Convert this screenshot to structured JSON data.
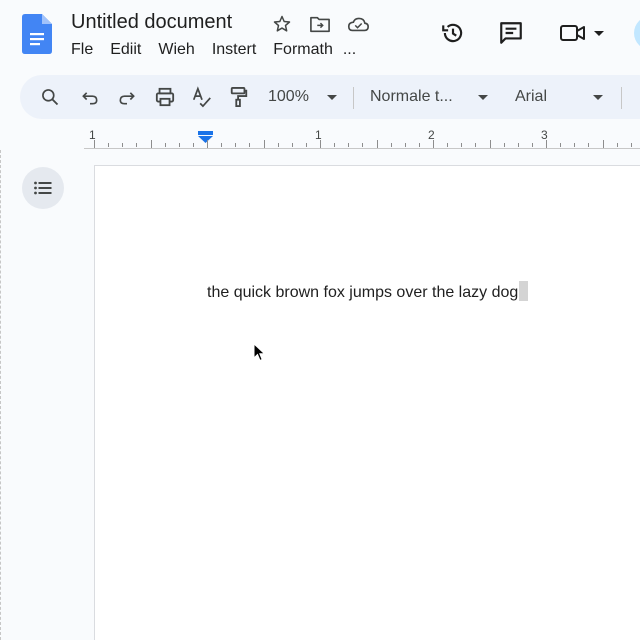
{
  "header": {
    "title": "Untitled document",
    "menu": [
      "Fle",
      "Ediit",
      "Wieh",
      "Instert",
      "Formath",
      "..."
    ],
    "title_icons": [
      "star-icon",
      "move-folder-icon",
      "cloud-status-icon"
    ],
    "right_icons": [
      "history-icon",
      "comments-icon",
      "meet-video-icon"
    ]
  },
  "toolbar": {
    "icons": [
      "search-icon",
      "undo-icon",
      "redo-icon",
      "print-icon",
      "spellcheck-icon",
      "paint-format-icon"
    ],
    "zoom": "100%",
    "style": "Normale t...",
    "font": "Arial"
  },
  "ruler": {
    "labels": [
      "1",
      "1",
      "2",
      "3"
    ]
  },
  "document": {
    "text": "the quick brown fox jumps over the lazy dog"
  },
  "colors": {
    "accent": "#1a73e8",
    "toolbar_bg": "#edf2fa",
    "page_bg": "#ffffff",
    "background": "#f9fbfd"
  }
}
